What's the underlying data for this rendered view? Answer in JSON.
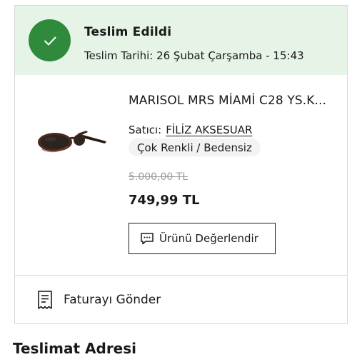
{
  "status": {
    "title": "Teslim Edildi",
    "date": "Teslim Tarihi: 26 Şubat Çarşamba - 15:43",
    "icon": "check-icon",
    "color": "#2f8a3c"
  },
  "product": {
    "title": "MARISOL MRS MİAMİ C28 YS.K...",
    "seller_label": "Satıcı:",
    "seller_name": "FİLİZ AKSESUAR",
    "variant": "Çok Renkli / Bedensiz",
    "old_price": "5.000,00 TL",
    "price": "749,99 TL",
    "review_button": "Ürünü Değerlendir",
    "image": "sunglasses"
  },
  "invoice": {
    "label": "Faturayı Gönder",
    "icon": "invoice-icon"
  },
  "next_section": {
    "heading": "Teslimat Adresi"
  }
}
